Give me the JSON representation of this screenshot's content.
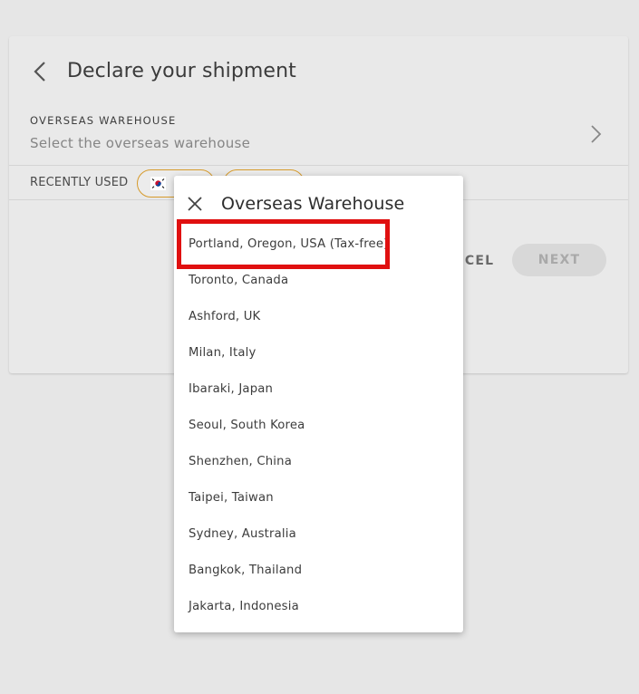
{
  "page": {
    "title": "Declare your shipment",
    "back_icon": "chevron-left-icon"
  },
  "overseas_warehouse": {
    "label": "OVERSEAS WAREHOUSE",
    "placeholder": "Select the overseas warehouse",
    "chevron_icon": "chevron-right-icon"
  },
  "recently_used": {
    "label": "RECENTLY USED",
    "chips": [
      {
        "flag": "south-korea-flag-icon"
      },
      {
        "flag": ""
      }
    ]
  },
  "actions": {
    "cancel_label": "NCEL",
    "next_label": "NEXT"
  },
  "popup": {
    "title": "Overseas Warehouse",
    "close_icon": "close-icon",
    "items": [
      "Portland, Oregon, USA (Tax-free)",
      "Toronto, Canada",
      "Ashford, UK",
      "Milan, Italy",
      "Ibaraki, Japan",
      "Seoul, South Korea",
      "Shenzhen, China",
      "Taipei, Taiwan",
      "Sydney, Australia",
      "Bangkok, Thailand",
      "Jakarta, Indonesia"
    ]
  },
  "colors": {
    "highlight": "#e01010",
    "chip_border": "#d69a2a"
  }
}
